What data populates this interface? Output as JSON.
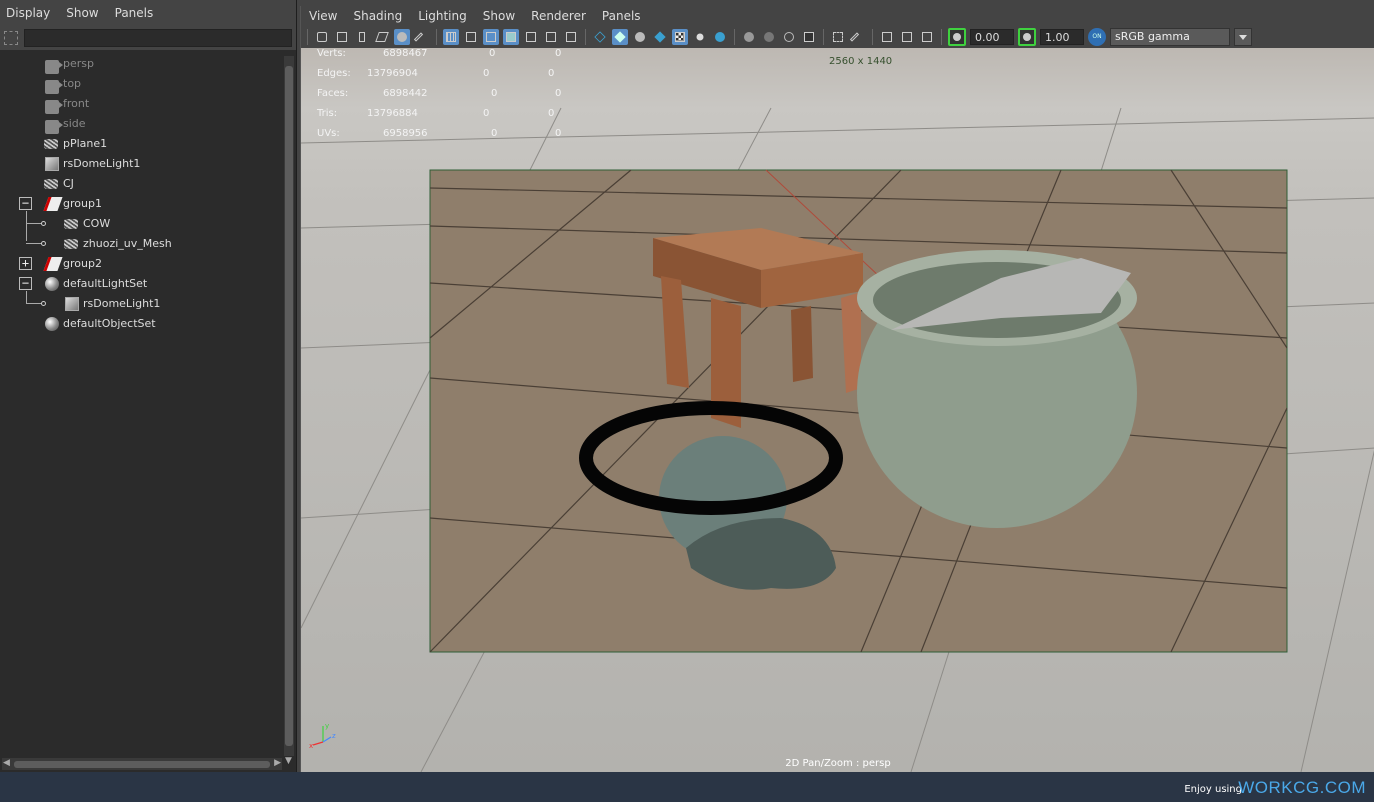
{
  "outliner": {
    "menu": [
      "Display",
      "Show",
      "Panels"
    ],
    "search_value": "",
    "items": [
      {
        "label": "persp",
        "icon": "camera-icon",
        "dim": true
      },
      {
        "label": "top",
        "icon": "camera-icon",
        "dim": true
      },
      {
        "label": "front",
        "icon": "camera-icon",
        "dim": true
      },
      {
        "label": "side",
        "icon": "camera-icon",
        "dim": true
      },
      {
        "label": "pPlane1",
        "icon": "mesh-icon"
      },
      {
        "label": "rsDomeLight1",
        "icon": "dome-light-icon"
      },
      {
        "label": "CJ",
        "icon": "mesh-icon"
      },
      {
        "label": "group1",
        "icon": "group-icon",
        "expander": "−"
      },
      {
        "label": "COW",
        "icon": "mesh-icon"
      },
      {
        "label": "zhuozi_uv_Mesh",
        "icon": "mesh-icon"
      },
      {
        "label": "group2",
        "icon": "group-icon",
        "expander": "+"
      },
      {
        "label": "defaultLightSet",
        "icon": "set-icon",
        "expander": "−"
      },
      {
        "label": "rsDomeLight1",
        "icon": "dome-light-icon"
      },
      {
        "label": "defaultObjectSet",
        "icon": "set-icon"
      }
    ]
  },
  "viewport": {
    "menu": [
      "View",
      "Shading",
      "Lighting",
      "Show",
      "Renderer",
      "Panels"
    ],
    "exposure": "0.00",
    "gamma": "1.00",
    "color_management_toggle": "ON",
    "color_space": "sRGB gamma",
    "resolution": "2560 x 1440",
    "status": "2D Pan/Zoom : persp",
    "hud": [
      {
        "label": "Verts:",
        "v1": "6898467",
        "v2": "0",
        "v3": "0"
      },
      {
        "label": "Edges:",
        "v1": "13796904",
        "v2": "0",
        "v3": "0"
      },
      {
        "label": "Faces:",
        "v1": "6898442",
        "v2": "0",
        "v3": "0"
      },
      {
        "label": "Tris:",
        "v1": "13796884",
        "v2": "0",
        "v3": "0"
      },
      {
        "label": "UVs:",
        "v1": "6958956",
        "v2": "0",
        "v3": "0"
      }
    ],
    "axis": {
      "x": "x",
      "y": "y",
      "z": "z"
    }
  },
  "footer": {
    "prefix": "Enjoy using",
    "brand": "WORKCG.COM"
  },
  "colors": {
    "accent": "#5a8fc7",
    "brand": "#4aa8e8",
    "exposure_highlight": "#3fd23f"
  }
}
